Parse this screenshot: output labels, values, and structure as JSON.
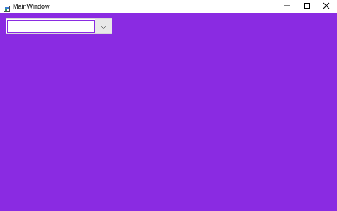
{
  "window": {
    "title": "MainWindow",
    "background_color": "#8a2be2",
    "titlebar_color": "#ffffff",
    "icons": {
      "app": "application-icon",
      "minimize": "minimize-icon",
      "maximize": "maximize-icon",
      "close": "close-icon"
    }
  },
  "combo": {
    "selected_value": "",
    "dropdown_icon": "chevron-down-icon"
  }
}
